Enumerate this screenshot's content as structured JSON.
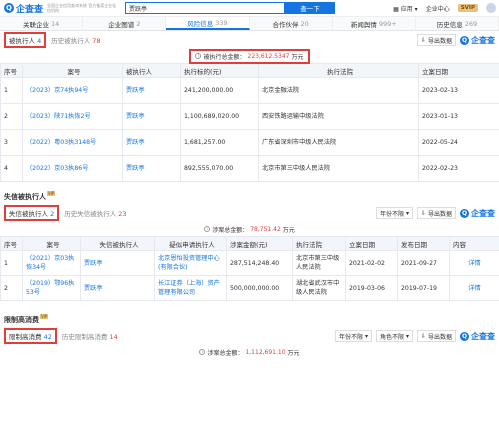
{
  "topbar": {
    "logo_text": "企查查",
    "tagline": "全国企业信用查询系统 官方备案企业征信机构",
    "search_value": "贾跃亭",
    "search_button": "查一下",
    "app_label": "应用",
    "enterprise_center": "企业中心",
    "vip_label": "SVIP"
  },
  "tabs": [
    {
      "label": "关联企业",
      "count": "14"
    },
    {
      "label": "企业图谱",
      "count": "2"
    },
    {
      "label": "风险信息",
      "count": "339"
    },
    {
      "label": "合作伙伴",
      "count": "20"
    },
    {
      "label": "新闻舆情",
      "count": "999+"
    },
    {
      "label": "历史信息",
      "count": "269"
    }
  ],
  "executed": {
    "chip_label": "被执行人",
    "chip_count": "4",
    "history_label": "历史被执行人",
    "history_count": "78",
    "export_label": "导出数据",
    "brand": "企查查",
    "total_label": "被执行总金额：",
    "total_amount": "223,612.5347",
    "total_unit": "万元",
    "columns": [
      "序号",
      "案号",
      "被执行人",
      "执行标的(元)",
      "执行法院",
      "立案日期"
    ],
    "rows": [
      {
        "no": "1",
        "case": "（2023）京74执94号",
        "person": "贾跃亭",
        "amount": "241,200,000.00",
        "court": "北京金融法院",
        "date": "2023-02-13"
      },
      {
        "no": "2",
        "case": "（2023）陕71执恢2号",
        "person": "贾跃亭",
        "amount": "1,100,689,020.00",
        "court": "西安铁路运输中级法院",
        "date": "2023-01-13"
      },
      {
        "no": "3",
        "case": "（2022）粤03执3148号",
        "person": "贾跃亭",
        "amount": "1,681,257.00",
        "court": "广东省深圳市中级人民法院",
        "date": "2022-05-24"
      },
      {
        "no": "4",
        "case": "（2022）京03执86号",
        "person": "贾跃亭",
        "amount": "892,555,070.00",
        "court": "北京市第三中级人民法院",
        "date": "2022-02-23"
      }
    ]
  },
  "dishonest": {
    "title": "失信被执行人",
    "vip_tag": "VIP",
    "chip_label": "失信被执行人",
    "chip_count": "2",
    "history_label": "历史失信被执行人",
    "history_count": "23",
    "year_filter": "年份不限",
    "export_label": "导出数据",
    "brand": "企查查",
    "total_label": "涉案总金额：",
    "total_amount": "78,751.42",
    "total_unit": "万元",
    "columns": [
      "序号",
      "案号",
      "失信被执行人",
      "疑似申请执行人",
      "涉案金额(元)",
      "执行法院",
      "立案日期",
      "发布日期",
      "内容"
    ],
    "rows": [
      {
        "no": "1",
        "case": "（2021）京03执恢34号",
        "person": "贾跃亭",
        "applicant": "北京恩怡投资管理中心(有限合伙)",
        "amount": "287,514,248.40",
        "court": "北京市第三中级人民法院",
        "filed": "2021-02-02",
        "published": "2021-09-27",
        "detail": "详情"
      },
      {
        "no": "2",
        "case": "（2019）鄂96执53号",
        "person": "贾跃亭",
        "applicant": "长江证券（上海）资产管理有限公司",
        "amount": "500,000,000.00",
        "court": "湖北省武汉市中级人民法院",
        "filed": "2019-03-06",
        "published": "2019-07-19",
        "detail": "详情"
      }
    ]
  },
  "restricted": {
    "title": "限制高消费",
    "vip_tag": "VIP",
    "chip_label": "限制高消费",
    "chip_count": "42",
    "history_label": "历史限制高消费",
    "history_count": "14",
    "year_filter": "年份不限",
    "role_filter": "角色不限",
    "export_label": "导出数据",
    "brand": "企查查",
    "total_label": "涉案总金额：",
    "total_amount": "1,112,691.10",
    "total_unit": "万元"
  }
}
